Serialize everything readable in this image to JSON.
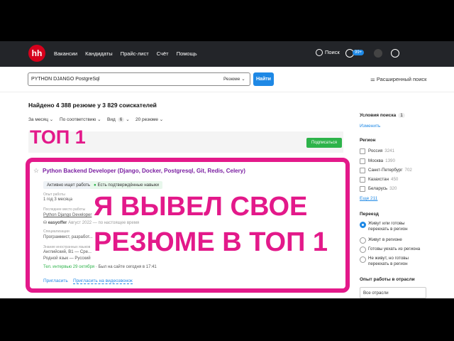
{
  "header": {
    "logo": "hh",
    "nav": [
      "Вакансии",
      "Кандидаты",
      "Прайс-лист",
      "Счёт",
      "Помощь"
    ],
    "search_label": "Поиск",
    "badge": "99+"
  },
  "search": {
    "query": "PYTHON DJANGO PostgreSql",
    "scope": "Резюме",
    "find_button": "Найти",
    "advanced": "Расширенный поиск"
  },
  "results": {
    "found": "Найдено 4 388 резюме у 3 829 соискателей",
    "filter_period": "За месяц",
    "filter_sort": "По соответствию",
    "filter_view": "Вид",
    "filter_view_count": "6",
    "filter_per_page": "20 резюме",
    "subscribe": "Подписаться"
  },
  "overlay": {
    "top1": "ТОП 1",
    "big_line1": "Я ВЫВЕЛ СВОЕ",
    "big_line2": "РЕЗЮМЕ В ТОП 1",
    "accent_color": "#e3198a"
  },
  "card": {
    "title": "Python Backend Developer (Django, Docker, Postgresql, Git, Redis, Celery)",
    "status": "Активно ищет работы",
    "verified": "Есть подтверждённые навыки",
    "exp_label": "Опыт работы",
    "exp_value": "1 год 3 месяца",
    "last_label": "Последнее место работы",
    "last_value": "Python Django Developer",
    "company": "easyoffer",
    "company_period": "Август 2022 — по настоящее время",
    "spec_label": "Специализации",
    "spec_value": "Программист, разработ...",
    "lang_label": "Знание иностранных языков",
    "lang_value": "Английский, B1 — Сре...",
    "native": "Родной язык — Русский",
    "tel": "Тел. интервью 29 октября",
    "seen": "· Был на сайте сегодня в 17:41",
    "invite": "Пригласить",
    "invite_video": "Пригласить на видеозвонок"
  },
  "sidebar": {
    "conditions_title": "Условия поиска",
    "conditions_count": "1",
    "change": "Изменить",
    "region_title": "Регион",
    "regions": [
      {
        "name": "Россия",
        "count": "3241"
      },
      {
        "name": "Москва",
        "count": "1390"
      },
      {
        "name": "Санкт-Петербург",
        "count": "702"
      },
      {
        "name": "Казахстан",
        "count": "450"
      },
      {
        "name": "Беларусь",
        "count": "320"
      }
    ],
    "more": "Еще 211",
    "relocation_title": "Переезд",
    "relocation": [
      "Живут или готовы переехать в регион",
      "Живут в регионе",
      "Готовы уехать из региона",
      "Не живут, но готовы переехать в регион"
    ],
    "industry_title": "Опыт работы в отрасли",
    "industry_select": "Все отрасли"
  }
}
